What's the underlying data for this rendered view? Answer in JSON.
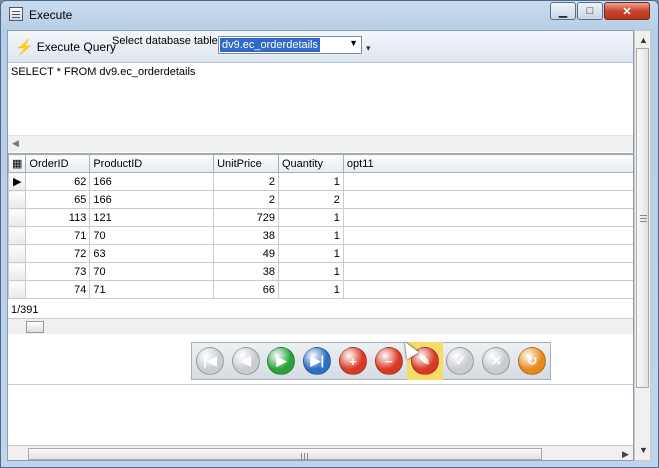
{
  "window": {
    "title": "Execute",
    "min_symbol": "▁",
    "max_symbol": "□",
    "close_symbol": "✕"
  },
  "toolbar": {
    "execute_label": "Execute Query",
    "execute_icon": "lightning-bolt-icon",
    "table_label": "Select database table",
    "table_value": "dv9.ec_orderdetails"
  },
  "sql": {
    "text": "SELECT * FROM dv9.ec_orderdetails"
  },
  "grid": {
    "columns": [
      "OrderID",
      "ProductID",
      "UnitPrice",
      "Quantity",
      "opt11"
    ],
    "rows": [
      [
        "62",
        "166",
        "2",
        "1",
        ""
      ],
      [
        "65",
        "166",
        "2",
        "2",
        ""
      ],
      [
        "113",
        "121",
        "729",
        "1",
        ""
      ],
      [
        "71",
        "70",
        "38",
        "1",
        ""
      ],
      [
        "72",
        "63",
        "49",
        "1",
        ""
      ],
      [
        "73",
        "70",
        "38",
        "1",
        ""
      ],
      [
        "74",
        "71",
        "66",
        "1",
        ""
      ]
    ],
    "record_position": "1/391"
  },
  "navigator": {
    "buttons": [
      {
        "name": "first-record-button",
        "icon": "first-icon",
        "symbol": "|◀",
        "color": "#c9ccd0",
        "enabled": false
      },
      {
        "name": "prior-record-button",
        "icon": "prior-icon",
        "symbol": "◀",
        "color": "#c9ccd0",
        "enabled": false
      },
      {
        "name": "next-record-button",
        "icon": "next-icon",
        "symbol": "▶",
        "color": "#2aa33a",
        "enabled": true
      },
      {
        "name": "last-record-button",
        "icon": "last-icon",
        "symbol": "▶|",
        "color": "#2b6fc4",
        "enabled": true
      },
      {
        "name": "insert-record-button",
        "icon": "plus-icon",
        "symbol": "+",
        "color": "#d93a25",
        "enabled": true
      },
      {
        "name": "delete-record-button",
        "icon": "minus-icon",
        "symbol": "−",
        "color": "#d93a25",
        "enabled": true
      },
      {
        "name": "edit-record-button",
        "icon": "wrench-icon",
        "symbol": "✎",
        "color": "#d93a25",
        "enabled": true,
        "highlight": true
      },
      {
        "name": "post-edit-button",
        "icon": "check-icon",
        "symbol": "✓",
        "color": "#c9ccd0",
        "enabled": false
      },
      {
        "name": "cancel-edit-button",
        "icon": "x-icon",
        "symbol": "✕",
        "color": "#c9ccd0",
        "enabled": false
      },
      {
        "name": "refresh-button",
        "icon": "refresh-icon",
        "symbol": "↻",
        "color": "#e88a1a",
        "enabled": true
      }
    ]
  }
}
